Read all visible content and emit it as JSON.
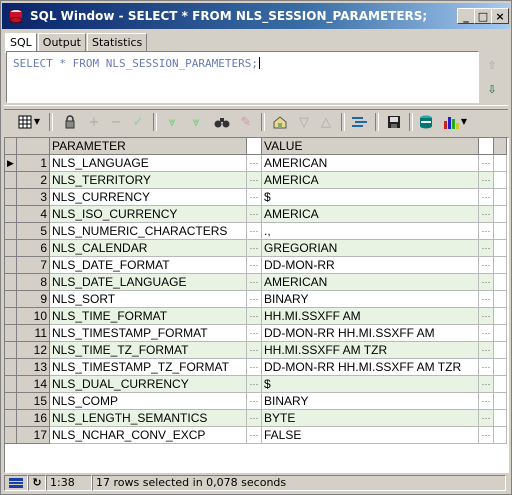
{
  "window": {
    "title": "SQL Window - SELECT * FROM NLS_SESSION_PARAMETERS;",
    "title_color": "#ffffff",
    "titlebar_colors": [
      "#0a246a",
      "#a6caf0"
    ],
    "buttons": {
      "minimize": "_",
      "maximize": "□",
      "close": "×"
    }
  },
  "tabs": [
    {
      "label": "SQL",
      "active": true
    },
    {
      "label": "Output",
      "active": false
    },
    {
      "label": "Statistics",
      "active": false
    }
  ],
  "editor": {
    "sql": "SELECT * FROM NLS_SESSION_PARAMETERS;",
    "text_color": "#6a7bb5"
  },
  "toolbar_icons": [
    "grid-menu-icon",
    "lock-icon",
    "add-row-icon",
    "delete-row-icon",
    "post-icon",
    "fetch-next-icon",
    "fetch-last-icon",
    "find-icon",
    "clear-icon",
    "query-by-example-icon",
    "filter-down-icon",
    "filter-up-icon",
    "export-icon",
    "save-icon",
    "export-results-icon",
    "chart-icon"
  ],
  "grid": {
    "columns": [
      "PARAMETER",
      "VALUE"
    ],
    "row_stripe_color": "#e8f3e4",
    "rows": [
      {
        "n": "1",
        "param": "NLS_LANGUAGE",
        "value": "AMERICAN"
      },
      {
        "n": "2",
        "param": "NLS_TERRITORY",
        "value": "AMERICA"
      },
      {
        "n": "3",
        "param": "NLS_CURRENCY",
        "value": "$"
      },
      {
        "n": "4",
        "param": "NLS_ISO_CURRENCY",
        "value": "AMERICA"
      },
      {
        "n": "5",
        "param": "NLS_NUMERIC_CHARACTERS",
        "value": ".,"
      },
      {
        "n": "6",
        "param": "NLS_CALENDAR",
        "value": "GREGORIAN"
      },
      {
        "n": "7",
        "param": "NLS_DATE_FORMAT",
        "value": "DD-MON-RR"
      },
      {
        "n": "8",
        "param": "NLS_DATE_LANGUAGE",
        "value": "AMERICAN"
      },
      {
        "n": "9",
        "param": "NLS_SORT",
        "value": "BINARY"
      },
      {
        "n": "10",
        "param": "NLS_TIME_FORMAT",
        "value": "HH.MI.SSXFF AM"
      },
      {
        "n": "11",
        "param": "NLS_TIMESTAMP_FORMAT",
        "value": "DD-MON-RR HH.MI.SSXFF AM"
      },
      {
        "n": "12",
        "param": "NLS_TIME_TZ_FORMAT",
        "value": "HH.MI.SSXFF AM TZR"
      },
      {
        "n": "13",
        "param": "NLS_TIMESTAMP_TZ_FORMAT",
        "value": "DD-MON-RR HH.MI.SSXFF AM TZR"
      },
      {
        "n": "14",
        "param": "NLS_DUAL_CURRENCY",
        "value": "$"
      },
      {
        "n": "15",
        "param": "NLS_COMP",
        "value": "BINARY"
      },
      {
        "n": "16",
        "param": "NLS_LENGTH_SEMANTICS",
        "value": "BYTE"
      },
      {
        "n": "17",
        "param": "NLS_NCHAR_CONV_EXCP",
        "value": "FALSE"
      }
    ],
    "current_row_marker": "▶",
    "cell_button": "···"
  },
  "statusbar": {
    "position": "1:38",
    "message": "17 rows selected in 0,078 seconds"
  }
}
